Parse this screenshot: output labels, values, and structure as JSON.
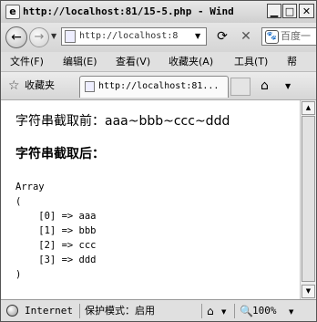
{
  "window": {
    "title": "http://localhost:81/15-5.php - Wind...",
    "min_glyph": "▁",
    "max_glyph": "□",
    "close_glyph": "✕"
  },
  "addressbar": {
    "url": "http://localhost:8",
    "search_placeholder": "百度一"
  },
  "menu": [
    {
      "label": "文件(F)"
    },
    {
      "label": "编辑(E)"
    },
    {
      "label": "查看(V)"
    },
    {
      "label": "收藏夹(A)"
    },
    {
      "label": "工具(T)"
    },
    {
      "label": "帮"
    }
  ],
  "favorites": {
    "label": "收藏夹",
    "tab_title": "http://localhost:81..."
  },
  "content": {
    "line1": "字符串截取前：aaa~bbb~ccc~ddd",
    "heading": "字符串截取后：",
    "array_output": "Array\n(\n    [0] => aaa\n    [1] => bbb\n    [2] => ccc\n    [3] => ddd\n)"
  },
  "status": {
    "zone": "Internet",
    "protected_mode": "保护模式：启用",
    "zoom": "100%"
  },
  "icons": [
    "ie-page-icon",
    "back-arrow-icon",
    "forward-arrow-icon",
    "refresh-icon",
    "stop-icon",
    "baidu-search-icon",
    "favorites-star-icon",
    "home-icon",
    "globe-icon",
    "security-icon",
    "zoom-icon"
  ]
}
